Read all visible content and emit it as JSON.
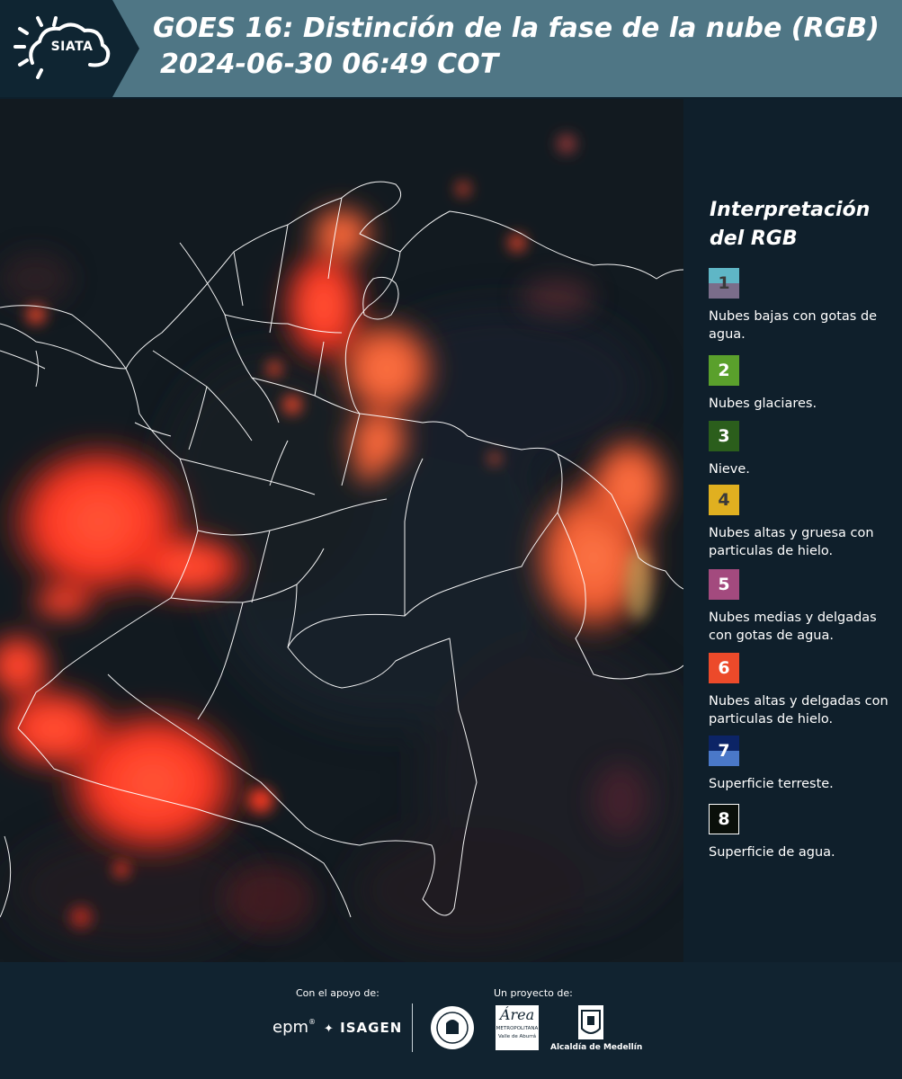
{
  "header": {
    "logo_text": "SIATA",
    "title_line1": "GOES 16: Distinción de la fase de la nube (RGB)",
    "title_line2": "2024-06-30 06:49 COT"
  },
  "legend": {
    "title_line1": "Interpretación",
    "title_line2": "del RGB",
    "items": [
      {
        "number": "1",
        "label": "Nubes bajas con gotas de agua.",
        "color_top": "#5fb6c6",
        "color_bottom": "#7a6d8a",
        "num_color": "#3a3a3a"
      },
      {
        "number": "2",
        "label": "Nubes glaciares.",
        "color_top": "#5aa02c",
        "color_bottom": "#5aa02c",
        "num_color": "#ffffff"
      },
      {
        "number": "3",
        "label": "Nieve.",
        "color_top": "#2b5e1c",
        "color_bottom": "#2b5e1c",
        "num_color": "#ffffff"
      },
      {
        "number": "4",
        "label": "Nubes altas y gruesa con particulas de hielo.",
        "color_top": "#e0b020",
        "color_bottom": "#e0b020",
        "num_color": "#3a3a3a"
      },
      {
        "number": "5",
        "label": "Nubes medias y delgadas con gotas de agua.",
        "color_top": "#a34a7e",
        "color_bottom": "#a34a7e",
        "num_color": "#ffffff"
      },
      {
        "number": "6",
        "label": "Nubes altas y delgadas con particulas de hielo.",
        "color_top": "#ec4a2a",
        "color_bottom": "#ec4a2a",
        "num_color": "#ffffff"
      },
      {
        "number": "7",
        "label": "Superficie terreste.",
        "color_top": "#0c2466",
        "color_bottom": "#4a78c8",
        "num_color": "#ffffff"
      },
      {
        "number": "8",
        "label": "Superficie de agua.",
        "color_top": "#0a0f0a",
        "color_bottom": "#0a0f0a",
        "num_color": "#ffffff"
      }
    ]
  },
  "footer": {
    "support_caption": "Con el apoyo de:",
    "project_caption": "Un proyecto de:",
    "sponsor_epm": "epm",
    "sponsor_isagen": "ISAGEN",
    "partner_area_line1": "Área",
    "partner_area_line2": "METROPOLITANA",
    "partner_area_line3": "Valle de Aburrá",
    "partner_alcaldia": "Alcaldía de Medellín"
  },
  "colors": {
    "header_bg": "#4f7685",
    "panel_bg": "#0f1f2b",
    "cloud_red": "#ff3a22",
    "cloud_orange": "#ff6a3a",
    "border_white": "#ffffff"
  }
}
